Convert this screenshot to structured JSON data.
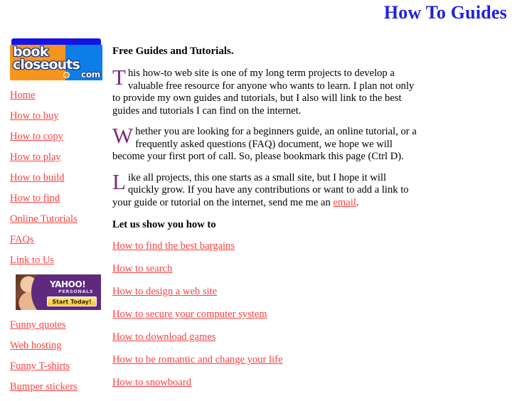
{
  "header": {
    "title": "How To Guides",
    "title_color": "#1f1fe0"
  },
  "sidebar": {
    "logo": {
      "line1": "book",
      "line2": "closeouts",
      "line3": "com",
      "alt": "bookcloseouts.com",
      "orange": "#f7941e",
      "blue": "#0d7de8",
      "topbar_blue": "#1414e8"
    },
    "nav_top": [
      {
        "label": "Home"
      },
      {
        "label": "How to buy"
      },
      {
        "label": "How to copy"
      },
      {
        "label": "How to play"
      },
      {
        "label": "How to build"
      },
      {
        "label": "How to find"
      },
      {
        "label": "Online Tutorials"
      },
      {
        "label": "FAQs"
      },
      {
        "label": "Link to Us"
      }
    ],
    "ad": {
      "brand": "YAHOO!",
      "sub": "PERSONALS",
      "button_label": "Start Today!",
      "bg": "#5f2a7e",
      "button_bg": "#f6c626"
    },
    "nav_bottom": [
      {
        "label": "Funny quotes"
      },
      {
        "label": "Web hosting"
      },
      {
        "label": "Funny T-shirts"
      },
      {
        "label": "Bumper stickers"
      }
    ],
    "link_color": "#ff4040"
  },
  "main": {
    "heading": "Free Guides and Tutorials.",
    "paragraphs": [
      {
        "dropcap": "T",
        "text": "his how-to web site is one of my long term projects to develop a valuable free resource for anyone who wants to learn. I plan not only to provide my own guides and tutorials, but I also will link to the best guides and tutorials I can find on the internet."
      },
      {
        "dropcap": "W",
        "text": "hether you are looking for a beginners guide, an online tutorial, or a frequently asked questions (FAQ) document, we hope we will become your first port of call. So, please bookmark this page (Ctrl D)."
      }
    ],
    "paragraph3": {
      "dropcap": "L",
      "text_before": "ike all projects, this one starts as a small site, but I hope it will quickly grow. If you have any contributions or want to add a link to your guide or tutorial on the internet, send me me an ",
      "link_label": "email",
      "text_after": "."
    },
    "section_heading": "Let us show you how to",
    "guides": [
      {
        "label": "How to find the best bargains"
      },
      {
        "label": "How to search"
      },
      {
        "label": "How to design a web site"
      },
      {
        "label": "How to secure your computer system"
      },
      {
        "label": "How to download games"
      },
      {
        "label": "How to be romantic and change your life"
      },
      {
        "label": "How to snowboard"
      }
    ],
    "dropcap_color": "#7d2a7d"
  }
}
